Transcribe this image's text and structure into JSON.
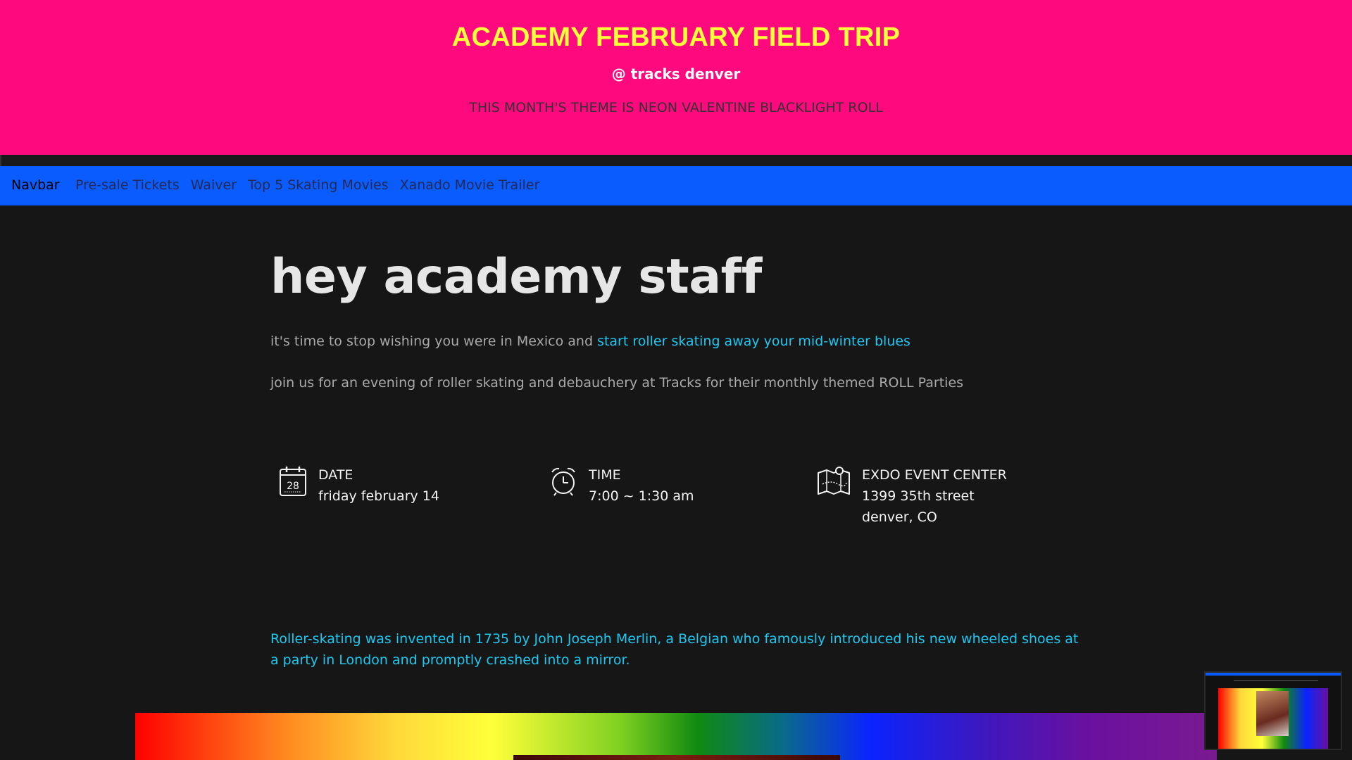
{
  "hero": {
    "title": "ACADEMY FEBRUARY FIELD TRIP",
    "subtitle": "@ tracks denver",
    "theme": "THIS MONTH'S THEME IS NEON VALENTINE BLACKLIGHT ROLL"
  },
  "navbar": {
    "brand": "Navbar",
    "links": [
      "Pre-sale Tickets",
      "Waiver",
      "Top 5 Skating Movies",
      "Xanado Movie Trailer"
    ]
  },
  "main": {
    "greeting": "hey academy staff",
    "intro_text": "it's time to stop wishing you were in Mexico and ",
    "intro_link": "start roller skating away your mid-winter blues",
    "join_text": "join us for an evening of roller skating and debauchery at Tracks for their monthly themed ROLL Parties"
  },
  "info": {
    "date": {
      "icon": "calendar-icon",
      "calendar_day": "28",
      "label": "DATE",
      "value": "friday february 14"
    },
    "time": {
      "icon": "alarm-clock-icon",
      "label": "TIME",
      "value": "7:00 ~ 1:30 am"
    },
    "place": {
      "icon": "map-icon",
      "label": "EXDO EVENT CENTER",
      "line1": "1399 35th street",
      "line2": "denver, CO"
    }
  },
  "fact": {
    "text": "Roller-skating was invented in 1735 by John Joseph Merlin, a Belgian who famously introduced his new wheeled shoes at a party in London and promptly crashed into a mirror."
  },
  "colors": {
    "hero_bg": "#ff0a7e",
    "hero_title": "#ffff3a",
    "navbar_bg": "#0a5cff",
    "page_bg": "#161616",
    "link": "#1ec8f0"
  }
}
